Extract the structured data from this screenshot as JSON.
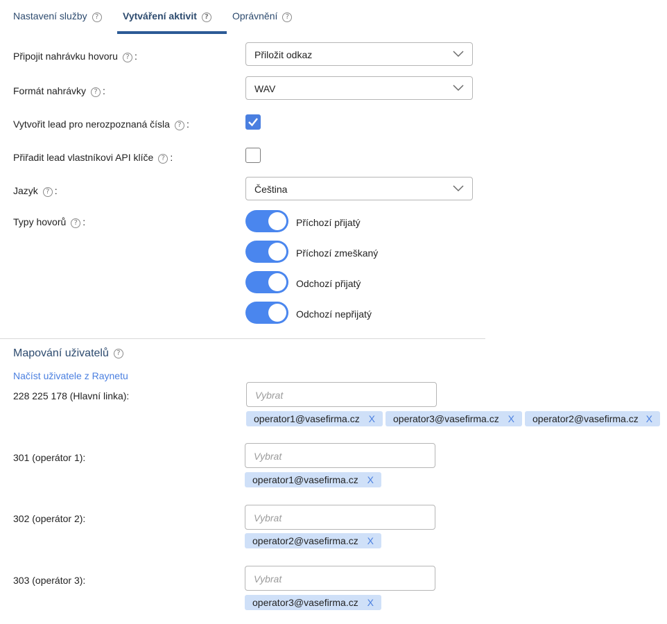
{
  "tabs": [
    {
      "label": "Nastavení služby",
      "active": false
    },
    {
      "label": "Vytváření aktivit",
      "active": true
    },
    {
      "label": "Oprávnění",
      "active": false
    }
  ],
  "settings": {
    "recording": {
      "label": "Připojit nahrávku hovoru",
      "value": "Přiložit odkaz"
    },
    "format": {
      "label": "Formát nahrávky",
      "value": "WAV"
    },
    "create_lead": {
      "label": "Vytvořit lead pro nerozpoznaná čísla",
      "checked": true
    },
    "assign_lead": {
      "label": "Přiřadit lead vlastníkovi API klíče",
      "checked": false
    },
    "language": {
      "label": "Jazyk",
      "value": "Čeština"
    },
    "call_types": {
      "label": "Typy hovorů",
      "items": [
        {
          "label": "Příchozí přijatý",
          "on": true
        },
        {
          "label": "Příchozí zmeškaný",
          "on": true
        },
        {
          "label": "Odchozí přijatý",
          "on": true
        },
        {
          "label": "Odchozí nepřijatý",
          "on": true
        }
      ]
    }
  },
  "mapping": {
    "title": "Mapování uživatelů",
    "load_link": "Načíst uživatele z Raynetu",
    "placeholder": "Vybrat",
    "remove_label": "X",
    "lines": [
      {
        "label": "228 225 178 (Hlavní linka):",
        "users": [
          "operator1@vasefirma.cz",
          "operator3@vasefirma.cz",
          "operator2@vasefirma.cz"
        ]
      },
      {
        "label": "301 (operátor 1):",
        "users": [
          "operator1@vasefirma.cz"
        ]
      },
      {
        "label": "302 (operátor 2):",
        "users": [
          "operator2@vasefirma.cz"
        ]
      },
      {
        "label": "303 (operátor 3):",
        "users": [
          "operator3@vasefirma.cz"
        ]
      }
    ]
  },
  "icons": {
    "help": "help-circle-icon",
    "dropdown": "chevron-down-icon",
    "check": "check-icon",
    "remove": "close-icon"
  },
  "colors": {
    "accent": "#4a86ee",
    "tab_active": "#2c5a96",
    "chip": "#cfe0f8",
    "link": "#4a7fe0"
  }
}
